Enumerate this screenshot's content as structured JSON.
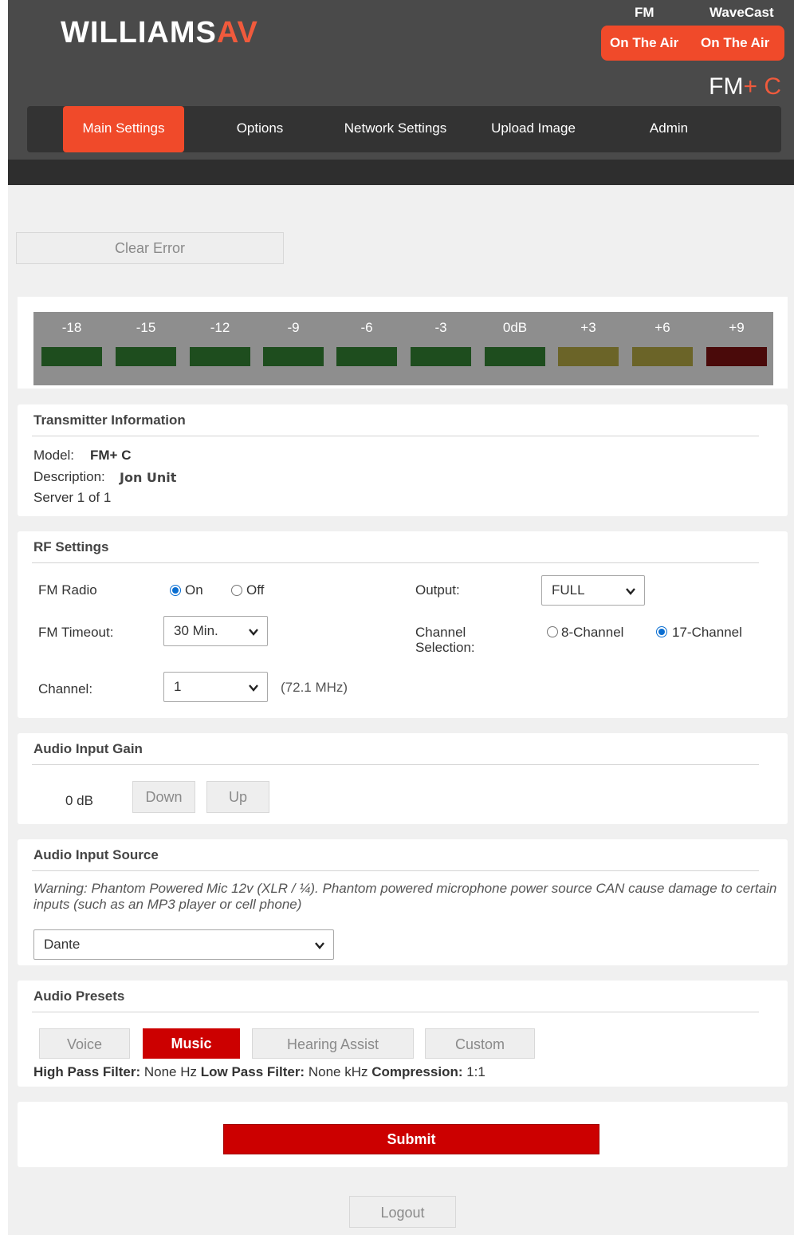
{
  "header": {
    "logo_main": "WILLIAMS",
    "logo_accent": "AV",
    "status_titles": [
      "FM",
      "WaveCast"
    ],
    "status_labels": [
      "On The Air",
      "On The Air"
    ],
    "model_badge": {
      "base": "FM",
      "plus": "+",
      "suffix": " C"
    },
    "colors": {
      "accent": "#f04a2a",
      "bg": "#4a4a4a"
    }
  },
  "nav": {
    "items": [
      "Main Settings",
      "Options",
      "Network Settings",
      "Upload Image",
      "Admin"
    ],
    "active": "Main Settings"
  },
  "clear_error_label": "Clear Error",
  "meter": {
    "labels": [
      "-18",
      "-15",
      "-12",
      "-9",
      "-6",
      "-3",
      "0dB",
      "+3",
      "+6",
      "+9"
    ],
    "colors": [
      "#1e4d1e",
      "#1e4d1e",
      "#1e4d1e",
      "#1e4d1e",
      "#1e4d1e",
      "#1e4d1e",
      "#1e4d1e",
      "#6b6428",
      "#6b6428",
      "#4a0a0a"
    ]
  },
  "transmitter": {
    "title": "Transmitter Information",
    "model_label": "Model:",
    "model_value": "FM+ C",
    "description_label": "Description:",
    "description_value": "Jon Unit",
    "server_text": "Server 1 of 1"
  },
  "rf": {
    "title": "RF Settings",
    "fm_radio_label": "FM Radio",
    "on_label": "On",
    "off_label": "Off",
    "fm_radio_value": "On",
    "output_label": "Output:",
    "output_value": "FULL",
    "fm_timeout_label": "FM Timeout:",
    "fm_timeout_value": "30 Min.",
    "channel_selection_label_1": "Channel",
    "channel_selection_label_2": "Selection:",
    "channel_8_label": "8-Channel",
    "channel_17_label": "17-Channel",
    "channel_selection_value": "17-Channel",
    "channel_label": "Channel:",
    "channel_value": "1",
    "channel_freq": "(72.1 MHz)"
  },
  "gain": {
    "title": "Audio Input Gain",
    "value": "0 dB",
    "down_label": "Down",
    "up_label": "Up"
  },
  "source": {
    "title": "Audio Input Source",
    "warning": "Warning: Phantom Powered Mic 12v (XLR / ¼). Phantom powered microphone power source CAN cause damage to certain inputs (such as an MP3 player or cell phone)",
    "value": "Dante"
  },
  "presets": {
    "title": "Audio Presets",
    "buttons": [
      "Voice",
      "Music",
      "Hearing Assist",
      "Custom"
    ],
    "active": "Music",
    "hpf_label": "High Pass Filter:",
    "hpf_value": " None Hz ",
    "lpf_label": "Low Pass Filter:",
    "lpf_value": " None kHz ",
    "comp_label": "Compression:",
    "comp_value": " 1:1"
  },
  "submit_label": "Submit",
  "logout_label": "Logout"
}
